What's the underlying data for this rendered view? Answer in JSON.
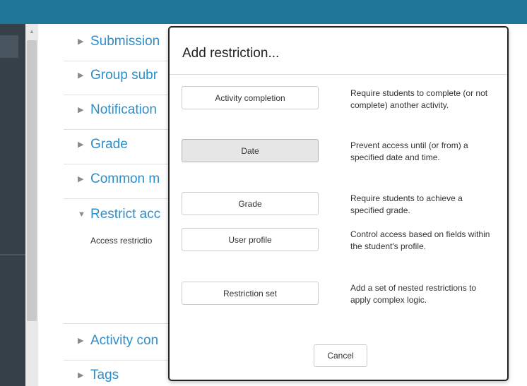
{
  "background": {
    "sections": [
      {
        "label": "Submission"
      },
      {
        "label": "Group subr"
      },
      {
        "label": "Notification"
      },
      {
        "label": "Grade"
      },
      {
        "label": "Common m"
      },
      {
        "label": "Restrict acc"
      },
      {
        "label": "Activity con"
      },
      {
        "label": "Tags"
      }
    ],
    "access_restrictions_label": "Access restrictio",
    "header_color": "#1f7696"
  },
  "modal": {
    "title": "Add restriction...",
    "options": [
      {
        "label": "Activity completion",
        "description": "Require students to complete (or not complete) another activity."
      },
      {
        "label": "Date",
        "description": "Prevent access until (or from) a specified date and time."
      },
      {
        "label": "Grade",
        "description": "Require students to achieve a specified grade."
      },
      {
        "label": "User profile",
        "description": "Control access based on fields within the student's profile."
      },
      {
        "label": "Restriction set",
        "description": "Add a set of nested restrictions to apply complex logic."
      }
    ],
    "cancel_label": "Cancel"
  }
}
